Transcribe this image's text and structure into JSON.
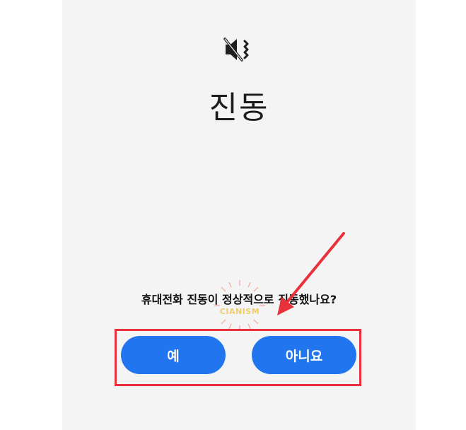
{
  "header": {
    "icon": "vibrate-icon",
    "title": "진동"
  },
  "dialog": {
    "question": "휴대전화 진동이 정상적으로 진동했나요?",
    "yes_label": "예",
    "no_label": "아니요"
  },
  "annotation": {
    "highlight_color": "#e8313a",
    "arrow_color": "#e8313a"
  },
  "watermark": {
    "text": "CIANISM"
  },
  "colors": {
    "button": "#2176f0",
    "background": "#f4f4f4"
  }
}
